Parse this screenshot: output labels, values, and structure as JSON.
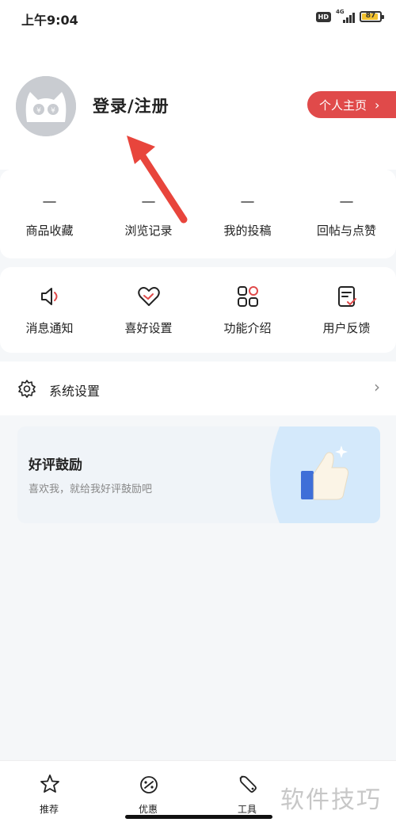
{
  "status_bar": {
    "time": "上午9:04",
    "hd_badge": "HD",
    "network": "4G",
    "battery": "87"
  },
  "header": {
    "login_text": "登录/注册",
    "profile_button": "个人主页",
    "profile_chevron": "›"
  },
  "stats": [
    {
      "value": "—",
      "label": "商品收藏"
    },
    {
      "value": "—",
      "label": "浏览记录"
    },
    {
      "value": "—",
      "label": "我的投稿"
    },
    {
      "value": "—",
      "label": "回帖与点赞"
    }
  ],
  "features": [
    {
      "icon": "speaker-icon",
      "label": "消息通知"
    },
    {
      "icon": "heart-icon",
      "label": "喜好设置"
    },
    {
      "icon": "grid-icon",
      "label": "功能介绍"
    },
    {
      "icon": "feedback-icon",
      "label": "用户反馈"
    }
  ],
  "settings": {
    "icon": "gear-icon",
    "label": "系统设置",
    "chevron": "›"
  },
  "rating": {
    "title": "好评鼓励",
    "subtitle": "喜欢我，就给我好评鼓励吧"
  },
  "tabbar": [
    {
      "icon": "star-icon",
      "label": "推荐"
    },
    {
      "icon": "coupon-icon",
      "label": "优惠"
    },
    {
      "icon": "wrench-icon",
      "label": "工具"
    }
  ],
  "watermark": "软件技巧",
  "colors": {
    "accent_red": "#e04a4a",
    "background": "#f5f7f9",
    "card": "#ffffff"
  }
}
